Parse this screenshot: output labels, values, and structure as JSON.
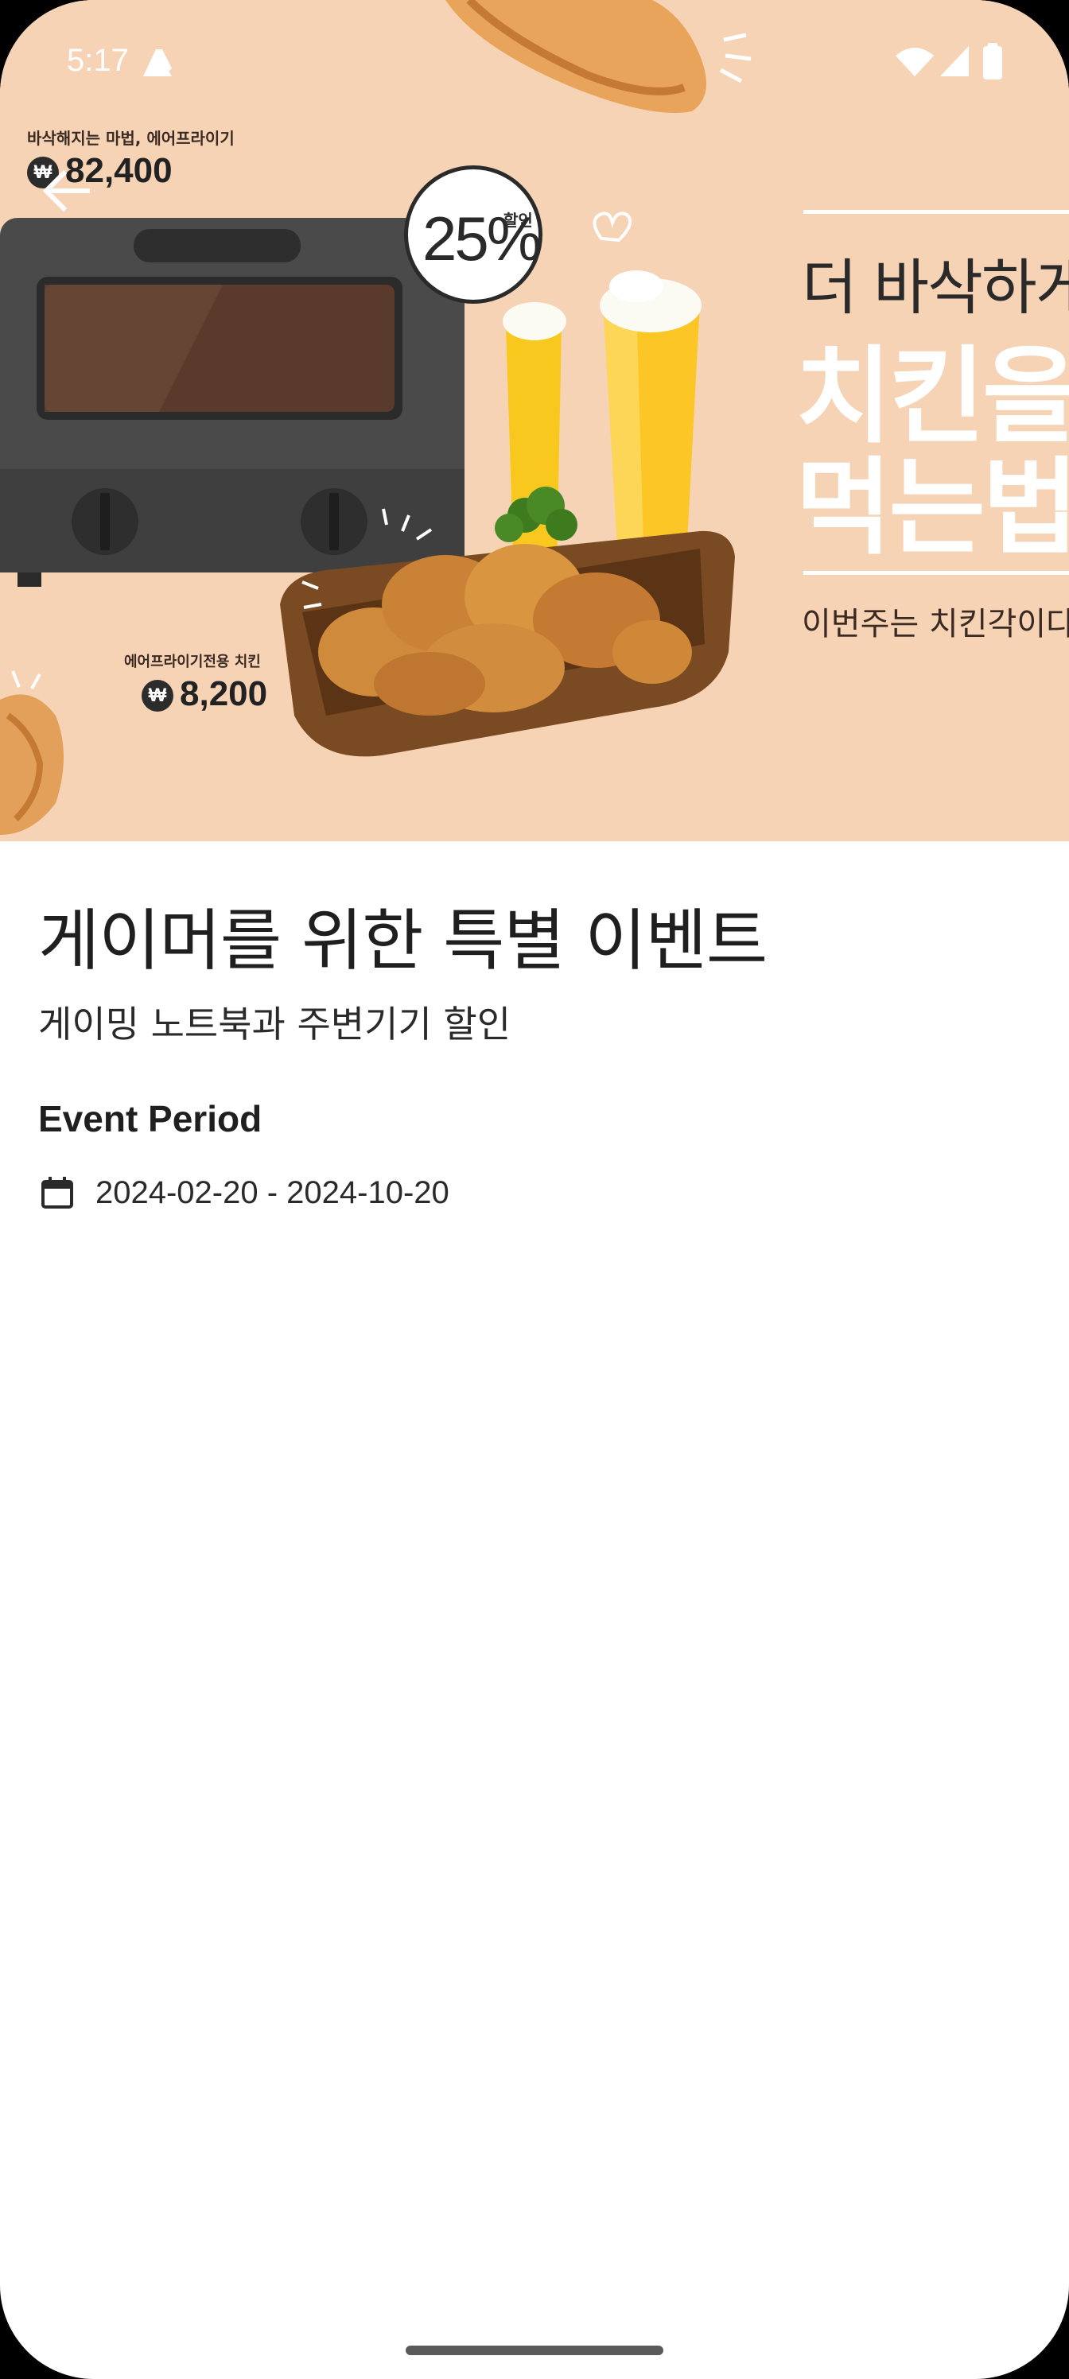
{
  "status_bar": {
    "time": "5:17"
  },
  "hero": {
    "promo_line_1": "바삭해지는 마법, 에어프라이기",
    "price_1": "82,400",
    "promo_line_2": "에어프라이기전용 치킨",
    "price_2": "8,200",
    "won_symbol": "₩",
    "discount_value": "25%",
    "discount_label": "할인",
    "headline_1": "더 바삭하게",
    "headline_2": "치킨을",
    "headline_3": "먹는법",
    "caption": "이번주는 치킨각이다"
  },
  "event": {
    "title": "게이머를 위한 특별 이벤트",
    "subtitle": "게이밍 노트북과 주변기기 할인",
    "period_heading": "Event Period",
    "period_value": "2024-02-20 - 2024-10-20"
  },
  "icons": {
    "back": "arrow-back-icon",
    "calendar": "calendar-icon",
    "wifi": "wifi-icon",
    "signal": "signal-icon",
    "battery": "battery-icon"
  },
  "colors": {
    "hero_background": "#f7d3b6",
    "text_primary": "#1f1f1f",
    "oven_body": "#4a4a4a"
  }
}
